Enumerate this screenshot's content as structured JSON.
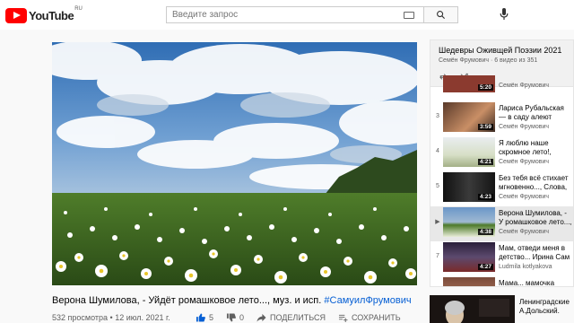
{
  "header": {
    "logo_text": "YouTube",
    "logo_region": "RU",
    "search_placeholder": "Введите запрос"
  },
  "video": {
    "title_main": "Верона Шумилова, - Уйдёт ромашковое лето..., муз. и исп. ",
    "title_hashtag": "#СамуилФрумович",
    "views": "532 просмотра",
    "date": "12 июл. 2021 г.",
    "likes": "5",
    "dislikes": "0",
    "share_label": "ПОДЕЛИТЬСЯ",
    "save_label": "СОХРАНИТЬ"
  },
  "playlist": {
    "title": "Шедевры Оживщей Поэзии 2021",
    "subtitle": "Семён Фрумович · 6 видео из 351",
    "items": [
      {
        "index": "",
        "title": "",
        "channel": "Семён Фрумович",
        "duration": "5:20"
      },
      {
        "index": "3",
        "title": "Лариса Рубальская — в саду алеют грозди,",
        "channel": "Семён Фрумович",
        "duration": "3:59"
      },
      {
        "index": "4",
        "title": "Я люблю наше скромное лето!, Стихи Лилия",
        "channel": "Семён Фрумович",
        "duration": "4:21"
      },
      {
        "index": "5",
        "title": "Без тебя всё стихает мгновенно..., Слова, м",
        "channel": "Семён Фрумович",
        "duration": "4:23"
      },
      {
        "index": "▶",
        "title": "Верона Шумилова, - У ромашковое лето..., м",
        "channel": "Семён Фрумович",
        "duration": "4:38"
      },
      {
        "index": "7",
        "title": "Мам, отведи меня в детство... Ирина Сам",
        "channel": "Ludmila kotlyakova",
        "duration": "4:27"
      },
      {
        "index": "8",
        "title": "Мама... мамочка",
        "channel": "",
        "duration": ""
      }
    ]
  },
  "recommendation": {
    "line1": "Ленинградские",
    "line2": "А.Дольский."
  },
  "colors": {
    "brand_red": "#ff0000",
    "link_blue": "#065fd4",
    "secondary_text": "#606060"
  }
}
